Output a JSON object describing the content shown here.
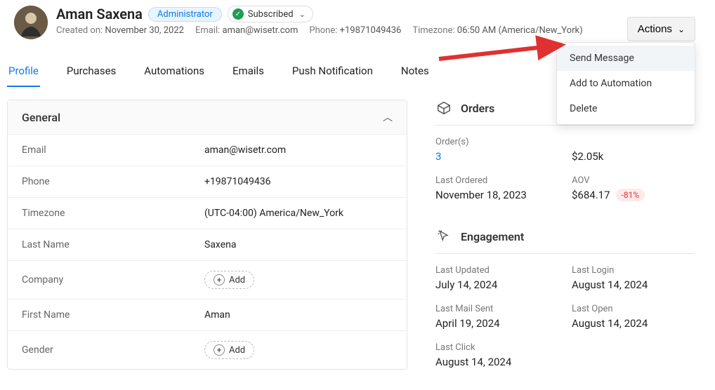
{
  "header": {
    "name": "Aman Saxena",
    "role_badge": "Administrator",
    "subscribed_label": "Subscribed",
    "created_label": "Created on:",
    "created_value": "November 30, 2022",
    "email_label": "Email:",
    "email_value": "aman@wisetr.com",
    "phone_label": "Phone:",
    "phone_value": "+19871049436",
    "timezone_label": "Timezone:",
    "timezone_value": "06:50 AM (America/New_York)"
  },
  "actions": {
    "button_label": "Actions",
    "menu": [
      "Send Message",
      "Add to Automation",
      "Delete"
    ]
  },
  "tabs": [
    "Profile",
    "Purchases",
    "Automations",
    "Emails",
    "Push Notification",
    "Notes"
  ],
  "general": {
    "title": "General",
    "fields": {
      "email": {
        "label": "Email",
        "value": "aman@wisetr.com"
      },
      "phone": {
        "label": "Phone",
        "value": "+19871049436"
      },
      "timezone": {
        "label": "Timezone",
        "value": "(UTC-04:00) America/New_York"
      },
      "last_name": {
        "label": "Last Name",
        "value": "Saxena"
      },
      "company": {
        "label": "Company",
        "add_label": "Add"
      },
      "first_name": {
        "label": "First Name",
        "value": "Aman"
      },
      "gender": {
        "label": "Gender",
        "add_label": "Add"
      }
    }
  },
  "orders": {
    "title": "Orders",
    "orders_label": "Order(s)",
    "orders_value": "3",
    "revenue_value": "$2.05k",
    "last_ordered_label": "Last Ordered",
    "last_ordered_value": "November 18, 2023",
    "aov_label": "AOV",
    "aov_value": "$684.17",
    "aov_change": "-81%"
  },
  "engagement": {
    "title": "Engagement",
    "stats": {
      "last_updated": {
        "label": "Last Updated",
        "value": "July 14, 2024"
      },
      "last_login": {
        "label": "Last Login",
        "value": "August 14, 2024"
      },
      "last_mail_sent": {
        "label": "Last Mail Sent",
        "value": "April 19, 2024"
      },
      "last_open": {
        "label": "Last Open",
        "value": "August 14, 2024"
      },
      "last_click": {
        "label": "Last Click",
        "value": "August 14, 2024"
      }
    }
  }
}
